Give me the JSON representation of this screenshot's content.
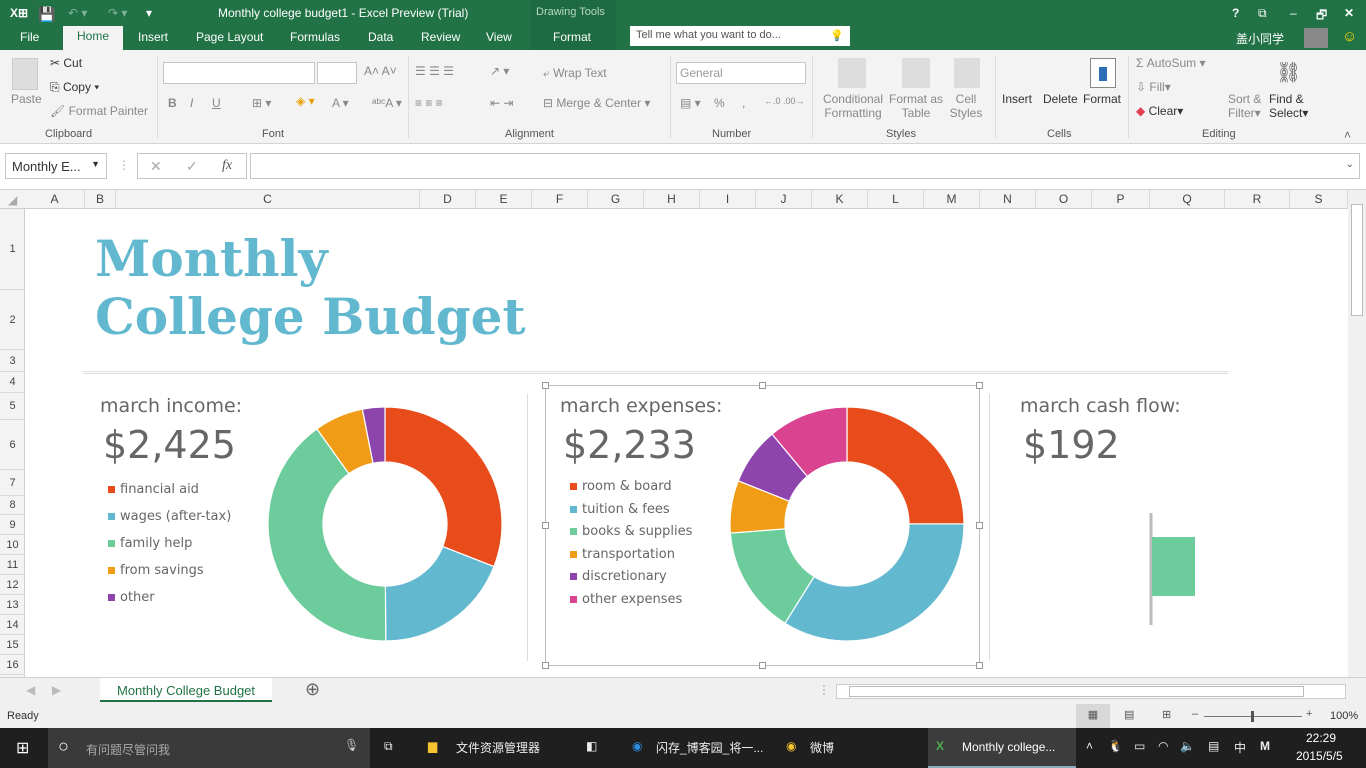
{
  "window": {
    "title": "Monthly college budget1 - Excel Preview (Trial)",
    "context_tab": "Drawing Tools",
    "user": "盖小同学",
    "controls": [
      "?",
      "⧉",
      "–",
      "🗗",
      "✕"
    ]
  },
  "tabs": [
    "File",
    "Home",
    "Insert",
    "Page Layout",
    "Formulas",
    "Data",
    "Review",
    "View",
    "Format"
  ],
  "tell_me": {
    "placeholder": "Tell me what you want to do..."
  },
  "ribbon": {
    "clipboard": {
      "paste": "Paste",
      "cut": "Cut",
      "copy": "Copy",
      "format_painter": "Format Painter",
      "label": "Clipboard"
    },
    "font": {
      "label": "Font",
      "bold": "B",
      "italic": "I",
      "underline": "U"
    },
    "alignment": {
      "wrap": "Wrap Text",
      "merge": "Merge & Center",
      "label": "Alignment"
    },
    "number": {
      "format": "General",
      "label": "Number",
      "percent": "%",
      "comma": ","
    },
    "styles": {
      "conditional": "Conditional",
      "conditional2": "Formatting",
      "format_table": "Format as",
      "format_table2": "Table",
      "cell_styles": "Cell",
      "cell_styles2": "Styles",
      "label": "Styles"
    },
    "cells": {
      "insert": "Insert",
      "delete": "Delete",
      "format": "Format",
      "label": "Cells"
    },
    "editing": {
      "autosum": "AutoSum",
      "fill": "Fill",
      "clear": "Clear",
      "sort": "Sort &",
      "sort2": "Filter",
      "find": "Find &",
      "find2": "Select",
      "label": "Editing"
    }
  },
  "formula_bar": {
    "name_box": "Monthly E...",
    "fx": "fx",
    "value": ""
  },
  "columns": [
    "A",
    "B",
    "C",
    "D",
    "E",
    "F",
    "G",
    "H",
    "I",
    "J",
    "K",
    "L",
    "M",
    "N",
    "O",
    "P",
    "Q",
    "R",
    "S"
  ],
  "rows": [
    "1",
    "2",
    "3",
    "4",
    "5",
    "6",
    "7",
    "8",
    "9",
    "10",
    "11",
    "12",
    "13",
    "14",
    "15",
    "16"
  ],
  "sheet": {
    "title1": "Monthly",
    "title2": "College Budget"
  },
  "income": {
    "title": "march income:",
    "total": "$2,425",
    "chart_data": {
      "type": "pie",
      "donut": true,
      "categories": [
        "financial aid",
        "wages (after-tax)",
        "family help",
        "from savings",
        "other"
      ],
      "values": [
        750,
        460,
        975,
        165,
        75
      ],
      "colors": [
        "#e84c1b",
        "#62b8cf",
        "#6ccc9c",
        "#f09c17",
        "#8e44ad"
      ]
    }
  },
  "expenses": {
    "title": "march expenses:",
    "total": "$2,233",
    "chart_data": {
      "type": "pie",
      "donut": true,
      "categories": [
        "room & board",
        "tuition & fees",
        "books & supplies",
        "transportation",
        "discretionary",
        "other expenses"
      ],
      "values": [
        558,
        757,
        332,
        162,
        177,
        247
      ],
      "colors": [
        "#e84c1b",
        "#62b8cf",
        "#6ccc9c",
        "#f09c17",
        "#8e44ad",
        "#d9438f"
      ]
    }
  },
  "cashflow": {
    "title": "march cash flow:",
    "total": "$192",
    "chart_data": {
      "type": "bar",
      "values": [
        192
      ],
      "colors": [
        "#6ccc9c"
      ]
    }
  },
  "sheet_tabs": [
    "Monthly College Budget"
  ],
  "status": {
    "ready": "Ready",
    "zoom": "100%"
  },
  "taskbar": {
    "search": "有问题尽管问我",
    "items": [
      "文件资源管理器",
      "闪存_博客园_将一...",
      "微博",
      "Monthly college..."
    ],
    "ime": "中",
    "time": "22:29",
    "date": "2015/5/5"
  }
}
